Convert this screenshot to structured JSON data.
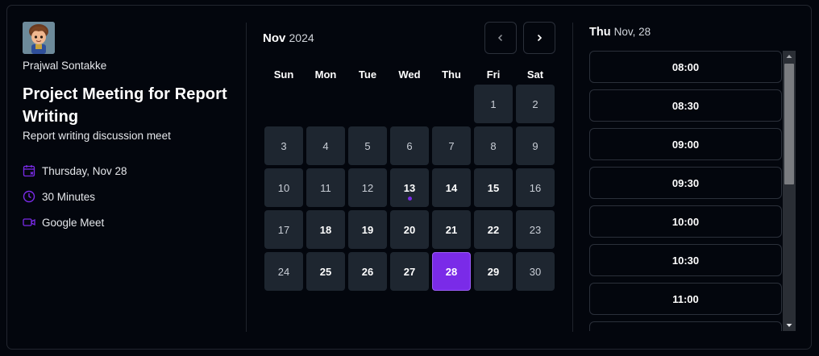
{
  "host": {
    "name": "Prajwal Sontakke",
    "avatar_icon": "cartoon-avatar-icon"
  },
  "event": {
    "title": "Project Meeting for Report Writing",
    "description": "Report writing discussion meet",
    "date": "Thursday, Nov 28",
    "duration": "30 Minutes",
    "location": "Google Meet"
  },
  "calendar": {
    "month": "Nov",
    "year": "2024",
    "weekdays": [
      "Sun",
      "Mon",
      "Tue",
      "Wed",
      "Thu",
      "Fri",
      "Sat"
    ],
    "leading_blanks": 5,
    "days": [
      {
        "label": "1",
        "available": false
      },
      {
        "label": "2",
        "available": false
      },
      {
        "label": "3",
        "available": false
      },
      {
        "label": "4",
        "available": false
      },
      {
        "label": "5",
        "available": false
      },
      {
        "label": "6",
        "available": false
      },
      {
        "label": "7",
        "available": false
      },
      {
        "label": "8",
        "available": false
      },
      {
        "label": "9",
        "available": false
      },
      {
        "label": "10",
        "available": false
      },
      {
        "label": "11",
        "available": false
      },
      {
        "label": "12",
        "available": false
      },
      {
        "label": "13",
        "available": true,
        "today": true
      },
      {
        "label": "14",
        "available": true
      },
      {
        "label": "15",
        "available": true
      },
      {
        "label": "16",
        "available": false
      },
      {
        "label": "17",
        "available": false
      },
      {
        "label": "18",
        "available": true
      },
      {
        "label": "19",
        "available": true
      },
      {
        "label": "20",
        "available": true
      },
      {
        "label": "21",
        "available": true
      },
      {
        "label": "22",
        "available": true
      },
      {
        "label": "23",
        "available": false
      },
      {
        "label": "24",
        "available": false
      },
      {
        "label": "25",
        "available": true
      },
      {
        "label": "26",
        "available": true
      },
      {
        "label": "27",
        "available": true
      },
      {
        "label": "28",
        "available": true,
        "selected": true
      },
      {
        "label": "29",
        "available": true
      },
      {
        "label": "30",
        "available": false
      }
    ]
  },
  "slots": {
    "day": "Thu",
    "date": "Nov, 28",
    "times": [
      "08:00",
      "08:30",
      "09:00",
      "09:30",
      "10:00",
      "10:30",
      "11:00",
      ""
    ]
  },
  "colors": {
    "accent": "#7a2be8",
    "background": "#03060d",
    "day_cell": "#1e2630"
  }
}
